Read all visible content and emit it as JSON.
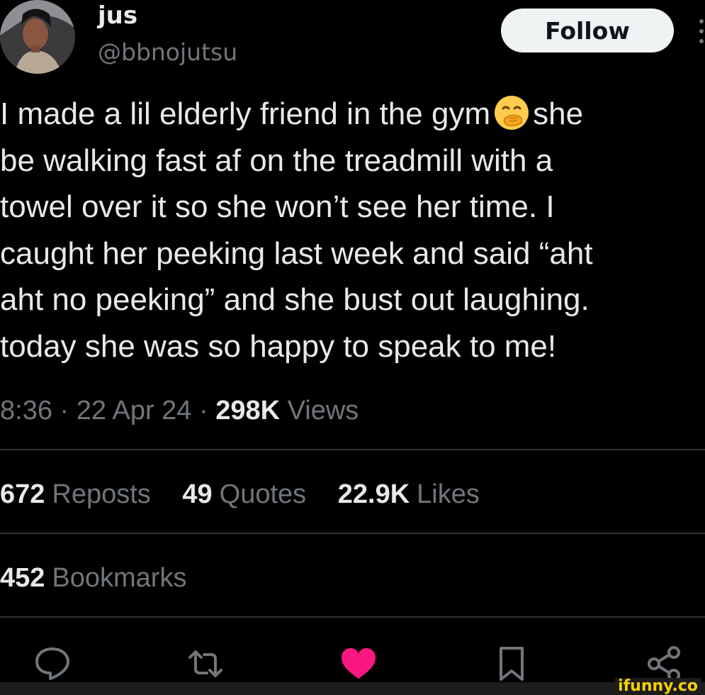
{
  "author": {
    "display_name": "jus",
    "handle": "@bbnojutsu"
  },
  "follow_button": {
    "label": "Follow"
  },
  "tweet": {
    "lines": [
      "I made a lil elderly friend in the gym",
      "be walking fast af on the treadmill with a",
      "towel over it so she won’t see her time. I",
      "caught her peeking last week and said “aht",
      "aht no peeking” and she bust out laughing.",
      "today she was so happy to speak to me!"
    ],
    "line1_after_emoji": "she",
    "emoji": "hand-over-mouth-emoji"
  },
  "meta": {
    "time": "8:36",
    "separator": "·",
    "date": "22 Apr 24",
    "views_count": "298K",
    "views_label": "Views"
  },
  "stats": {
    "reposts": {
      "count": "672",
      "label": "Reposts"
    },
    "quotes": {
      "count": "49",
      "label": "Quotes"
    },
    "likes": {
      "count": "22.9K",
      "label": "Likes"
    },
    "bookmarks": {
      "count": "452",
      "label": "Bookmarks"
    }
  },
  "actions": {
    "reply_icon": "speech-bubble-icon",
    "repost_icon": "repost-arrows-icon",
    "like_icon": "heart-icon",
    "bookmark_icon": "bookmark-icon",
    "share_icon": "share-nodes-icon"
  },
  "colors": {
    "background": "#000000",
    "text": "#e7e9ea",
    "secondary": "#71767b",
    "divider": "#2f3336",
    "like": "#f91880",
    "follow_bg": "#eff3f4",
    "watermark": "#f5d000"
  },
  "watermark": {
    "text": "ifunny.co"
  }
}
